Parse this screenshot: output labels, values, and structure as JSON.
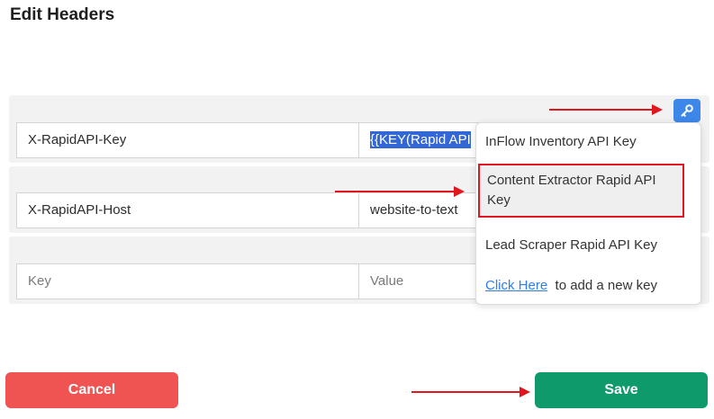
{
  "page": {
    "title": "Edit Headers"
  },
  "headers": [
    {
      "key": "X-RapidAPI-Key",
      "value": "{{KEY(Rapid API"
    },
    {
      "key": "X-RapidAPI-Host",
      "value": "website-to-text"
    },
    {
      "key": "",
      "value": ""
    }
  ],
  "new_row": {
    "key_placeholder": "Key",
    "value_placeholder": "Value"
  },
  "key_menu": {
    "button_icon": "key-icon",
    "items": [
      "InFlow Inventory API Key",
      "Content Extractor Rapid API Key",
      "Lead Scraper Rapid API Key"
    ],
    "highlighted_index": 1,
    "footer_link": "Click Here",
    "footer_text": "to add a new key"
  },
  "buttons": {
    "cancel": "Cancel",
    "save": "Save"
  },
  "colors": {
    "cancel": "#ef5453",
    "save": "#0e9a6a",
    "key_button": "#3d87e8",
    "annotation": "#e0171f",
    "selection": "#3367d6"
  }
}
